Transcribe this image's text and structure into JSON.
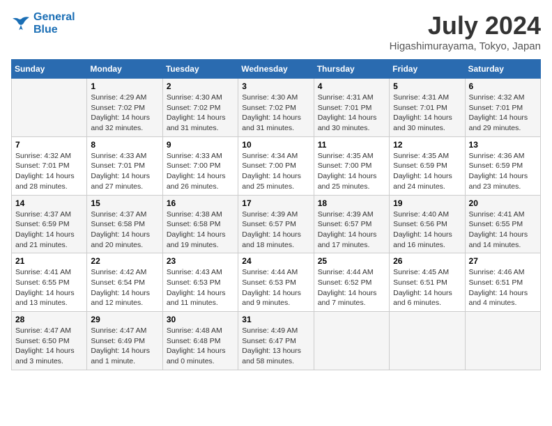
{
  "logo": {
    "line1": "General",
    "line2": "Blue"
  },
  "title": "July 2024",
  "location": "Higashimurayama, Tokyo, Japan",
  "headers": [
    "Sunday",
    "Monday",
    "Tuesday",
    "Wednesday",
    "Thursday",
    "Friday",
    "Saturday"
  ],
  "weeks": [
    [
      {
        "day": "",
        "info": ""
      },
      {
        "day": "1",
        "info": "Sunrise: 4:29 AM\nSunset: 7:02 PM\nDaylight: 14 hours\nand 32 minutes."
      },
      {
        "day": "2",
        "info": "Sunrise: 4:30 AM\nSunset: 7:02 PM\nDaylight: 14 hours\nand 31 minutes."
      },
      {
        "day": "3",
        "info": "Sunrise: 4:30 AM\nSunset: 7:02 PM\nDaylight: 14 hours\nand 31 minutes."
      },
      {
        "day": "4",
        "info": "Sunrise: 4:31 AM\nSunset: 7:01 PM\nDaylight: 14 hours\nand 30 minutes."
      },
      {
        "day": "5",
        "info": "Sunrise: 4:31 AM\nSunset: 7:01 PM\nDaylight: 14 hours\nand 30 minutes."
      },
      {
        "day": "6",
        "info": "Sunrise: 4:32 AM\nSunset: 7:01 PM\nDaylight: 14 hours\nand 29 minutes."
      }
    ],
    [
      {
        "day": "7",
        "info": "Sunrise: 4:32 AM\nSunset: 7:01 PM\nDaylight: 14 hours\nand 28 minutes."
      },
      {
        "day": "8",
        "info": "Sunrise: 4:33 AM\nSunset: 7:01 PM\nDaylight: 14 hours\nand 27 minutes."
      },
      {
        "day": "9",
        "info": "Sunrise: 4:33 AM\nSunset: 7:00 PM\nDaylight: 14 hours\nand 26 minutes."
      },
      {
        "day": "10",
        "info": "Sunrise: 4:34 AM\nSunset: 7:00 PM\nDaylight: 14 hours\nand 25 minutes."
      },
      {
        "day": "11",
        "info": "Sunrise: 4:35 AM\nSunset: 7:00 PM\nDaylight: 14 hours\nand 25 minutes."
      },
      {
        "day": "12",
        "info": "Sunrise: 4:35 AM\nSunset: 6:59 PM\nDaylight: 14 hours\nand 24 minutes."
      },
      {
        "day": "13",
        "info": "Sunrise: 4:36 AM\nSunset: 6:59 PM\nDaylight: 14 hours\nand 23 minutes."
      }
    ],
    [
      {
        "day": "14",
        "info": "Sunrise: 4:37 AM\nSunset: 6:59 PM\nDaylight: 14 hours\nand 21 minutes."
      },
      {
        "day": "15",
        "info": "Sunrise: 4:37 AM\nSunset: 6:58 PM\nDaylight: 14 hours\nand 20 minutes."
      },
      {
        "day": "16",
        "info": "Sunrise: 4:38 AM\nSunset: 6:58 PM\nDaylight: 14 hours\nand 19 minutes."
      },
      {
        "day": "17",
        "info": "Sunrise: 4:39 AM\nSunset: 6:57 PM\nDaylight: 14 hours\nand 18 minutes."
      },
      {
        "day": "18",
        "info": "Sunrise: 4:39 AM\nSunset: 6:57 PM\nDaylight: 14 hours\nand 17 minutes."
      },
      {
        "day": "19",
        "info": "Sunrise: 4:40 AM\nSunset: 6:56 PM\nDaylight: 14 hours\nand 16 minutes."
      },
      {
        "day": "20",
        "info": "Sunrise: 4:41 AM\nSunset: 6:55 PM\nDaylight: 14 hours\nand 14 minutes."
      }
    ],
    [
      {
        "day": "21",
        "info": "Sunrise: 4:41 AM\nSunset: 6:55 PM\nDaylight: 14 hours\nand 13 minutes."
      },
      {
        "day": "22",
        "info": "Sunrise: 4:42 AM\nSunset: 6:54 PM\nDaylight: 14 hours\nand 12 minutes."
      },
      {
        "day": "23",
        "info": "Sunrise: 4:43 AM\nSunset: 6:53 PM\nDaylight: 14 hours\nand 11 minutes."
      },
      {
        "day": "24",
        "info": "Sunrise: 4:44 AM\nSunset: 6:53 PM\nDaylight: 14 hours\nand 9 minutes."
      },
      {
        "day": "25",
        "info": "Sunrise: 4:44 AM\nSunset: 6:52 PM\nDaylight: 14 hours\nand 7 minutes."
      },
      {
        "day": "26",
        "info": "Sunrise: 4:45 AM\nSunset: 6:51 PM\nDaylight: 14 hours\nand 6 minutes."
      },
      {
        "day": "27",
        "info": "Sunrise: 4:46 AM\nSunset: 6:51 PM\nDaylight: 14 hours\nand 4 minutes."
      }
    ],
    [
      {
        "day": "28",
        "info": "Sunrise: 4:47 AM\nSunset: 6:50 PM\nDaylight: 14 hours\nand 3 minutes."
      },
      {
        "day": "29",
        "info": "Sunrise: 4:47 AM\nSunset: 6:49 PM\nDaylight: 14 hours\nand 1 minute."
      },
      {
        "day": "30",
        "info": "Sunrise: 4:48 AM\nSunset: 6:48 PM\nDaylight: 14 hours\nand 0 minutes."
      },
      {
        "day": "31",
        "info": "Sunrise: 4:49 AM\nSunset: 6:47 PM\nDaylight: 13 hours\nand 58 minutes."
      },
      {
        "day": "",
        "info": ""
      },
      {
        "day": "",
        "info": ""
      },
      {
        "day": "",
        "info": ""
      }
    ]
  ]
}
